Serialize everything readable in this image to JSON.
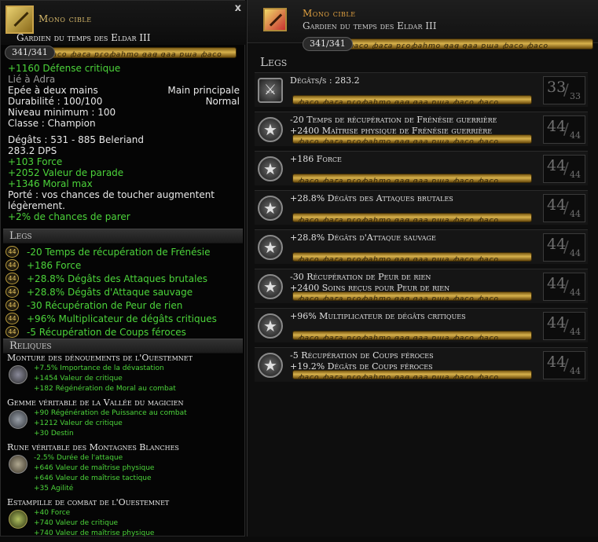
{
  "tooltip": {
    "category": "Mono cible",
    "close": "x",
    "item_name": "Gardien du temps des Eldar III",
    "xp": "341/341",
    "bar_runes": "ꞗaco ꞗaꞇa pɾoꞗahɱo ꞡaꞡ ꞡaa pɯa ꞗaco",
    "crit_defense": "+1160 Défense critique",
    "bound": "Lié à Adra",
    "type": "Epée à deux mains",
    "slot": "Main principale",
    "durability": "Durabilité : 100/100",
    "durability_state": "Normal",
    "min_level": "Niveau minimum : 100",
    "class": "Classe : Champion",
    "damage": "Dégâts : 531 - 885 Beleriand",
    "dps": "283.2 DPS",
    "stat_lines": [
      "+103 Force",
      "+2052 Valeur de parade",
      "+1346 Moral max"
    ],
    "reach_desc": "Porté : vos chances de toucher augmentent légèrement.",
    "parry": "+2% de chances de parer",
    "legs_title": "Legs",
    "legs": [
      {
        "level": "44",
        "text": "-20 Temps de récupération de Frénésie"
      },
      {
        "level": "44",
        "text": "+186 Force"
      },
      {
        "level": "44",
        "text": "+28.8% Dégâts des Attaques brutales"
      },
      {
        "level": "44",
        "text": "+28.8% Dégâts d'Attaque sauvage"
      },
      {
        "level": "44",
        "text": "-30 Récupération de Peur de rien"
      },
      {
        "level": "44",
        "text": "+96% Multiplicateur de dégâts critiques"
      },
      {
        "level": "44",
        "text": "-5 Récupération de Coups féroces"
      }
    ],
    "relics_title": "Reliques",
    "relics": [
      {
        "name": "Monture des dénouements de l'Ouestemnet",
        "stats": [
          "+7.5% Importance de la dévastation",
          "+1454 Valeur de critique",
          "+182 Régénération de Moral au combat"
        ]
      },
      {
        "name": "Gemme véritable de la Vallée du magicien",
        "stats": [
          "+90 Régénération de Puissance au combat",
          "+1212 Valeur de critique",
          "+30 Destin"
        ]
      },
      {
        "name": "Rune véritable des Montagnes Blanches",
        "stats": [
          "-2.5% Durée de l'attaque",
          "+646 Valeur de maîtrise physique",
          "+646 Valeur de maîtrise tactique",
          "+35 Agilité"
        ]
      },
      {
        "name": "Estampille de combat de l'Ouestemnet",
        "stats": [
          "+40 Force",
          "+740 Valeur de critique",
          "+740 Valeur de maîtrise physique"
        ]
      }
    ]
  },
  "panel": {
    "category": "Mono cible",
    "item_name": "Gardien du temps des Eldar III",
    "xp": "341/341",
    "bar_runes": "ꞗaco ꞗaꞇa pɾoꞗahɱo ꞡaꞡ ꞡaa pɯa ꞗaco ꞗaco",
    "legs_title": "Legs",
    "entries": [
      {
        "lines": [
          "Dégâts/s : 283.2"
        ],
        "level": "33",
        "max": "33",
        "icon": "sword"
      },
      {
        "lines": [
          "-20 Temps de récupération de Frénésie guerrière",
          "+2400 Maîtrise physique de Frénésie guerrière"
        ],
        "level": "44",
        "max": "44",
        "icon": "star"
      },
      {
        "lines": [
          "+186 Force"
        ],
        "level": "44",
        "max": "44",
        "icon": "star"
      },
      {
        "lines": [
          "+28.8% Dégâts des Attaques brutales"
        ],
        "level": "44",
        "max": "44",
        "icon": "star"
      },
      {
        "lines": [
          "+28.8% Dégâts d'Attaque sauvage"
        ],
        "level": "44",
        "max": "44",
        "icon": "star"
      },
      {
        "lines": [
          "-30 Récupération de Peur de rien",
          "+2400 Soins reçus pour Peur de rien"
        ],
        "level": "44",
        "max": "44",
        "icon": "star"
      },
      {
        "lines": [
          "+96% Multiplicateur de dégâts critiques"
        ],
        "level": "44",
        "max": "44",
        "icon": "star"
      },
      {
        "lines": [
          "-5 Récupération de Coups féroces",
          "+19.2% Dégâts de Coups féroces"
        ],
        "level": "44",
        "max": "44",
        "icon": "star"
      }
    ]
  }
}
